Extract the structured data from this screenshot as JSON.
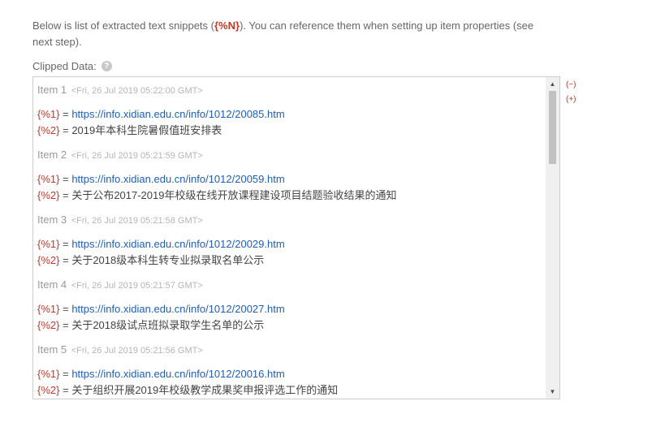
{
  "intro": {
    "before": "Below is list of extracted text snippets (",
    "token": "{%N}",
    "after": "). You can reference them when setting up item properties (see next step)."
  },
  "clipped_label": "Clipped Data:",
  "help_icon_glyph": "?",
  "controls": {
    "collapse": "(−)",
    "expand": "(+)"
  },
  "scrollbar": {
    "up": "▲",
    "down": "▼"
  },
  "items": [
    {
      "label": "Item 1",
      "timestamp": "<Fri, 26 Jul 2019 05:22:00 GMT>",
      "var1": "{%1}",
      "eq": " = ",
      "url": "https://info.xidian.edu.cn/info/1012/20085.htm",
      "var2": "{%2}",
      "text": "2019年本科生院暑假值班安排表"
    },
    {
      "label": "Item 2",
      "timestamp": "<Fri, 26 Jul 2019 05:21:59 GMT>",
      "var1": "{%1}",
      "eq": " = ",
      "url": "https://info.xidian.edu.cn/info/1012/20059.htm",
      "var2": "{%2}",
      "text": "关于公布2017-2019年校级在线开放课程建设项目结题验收结果的通知"
    },
    {
      "label": "Item 3",
      "timestamp": "<Fri, 26 Jul 2019 05:21:58 GMT>",
      "var1": "{%1}",
      "eq": " = ",
      "url": "https://info.xidian.edu.cn/info/1012/20029.htm",
      "var2": "{%2}",
      "text": "关于2018级本科生转专业拟录取名单公示"
    },
    {
      "label": "Item 4",
      "timestamp": "<Fri, 26 Jul 2019 05:21:57 GMT>",
      "var1": "{%1}",
      "eq": " = ",
      "url": "https://info.xidian.edu.cn/info/1012/20027.htm",
      "var2": "{%2}",
      "text": "关于2018级试点班拟录取学生名单的公示"
    },
    {
      "label": "Item 5",
      "timestamp": "<Fri, 26 Jul 2019 05:21:56 GMT>",
      "var1": "{%1}",
      "eq": " = ",
      "url": "https://info.xidian.edu.cn/info/1012/20016.htm",
      "var2": "{%2}",
      "text": "关于组织开展2019年校级教学成果奖申报评选工作的通知"
    }
  ]
}
